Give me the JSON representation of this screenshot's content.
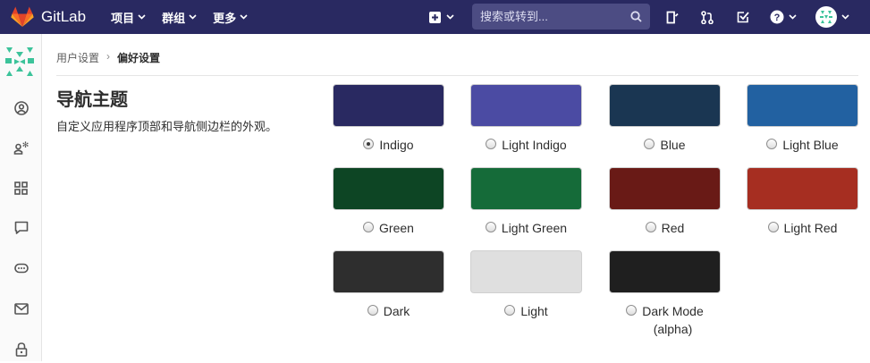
{
  "app": {
    "name": "GitLab"
  },
  "nav": {
    "menu": [
      {
        "label": "项目"
      },
      {
        "label": "群组"
      },
      {
        "label": "更多"
      }
    ],
    "search_placeholder": "搜索或转到..."
  },
  "breadcrumb": {
    "parent": "用户设置",
    "current": "偏好设置"
  },
  "section": {
    "title": "导航主题",
    "description": "自定义应用程序顶部和导航侧边栏的外观。"
  },
  "themes": [
    {
      "label": "Indigo",
      "color": "#292961",
      "selected": true
    },
    {
      "label": "Light Indigo",
      "color": "#4b4ba3",
      "selected": false
    },
    {
      "label": "Blue",
      "color": "#1a3652",
      "selected": false
    },
    {
      "label": "Light Blue",
      "color": "#2261a1",
      "selected": false
    },
    {
      "label": "Green",
      "color": "#0d4524",
      "selected": false
    },
    {
      "label": "Light Green",
      "color": "#156b39",
      "selected": false
    },
    {
      "label": "Red",
      "color": "#691a16",
      "selected": false
    },
    {
      "label": "Light Red",
      "color": "#a62e21",
      "selected": false
    },
    {
      "label": "Dark",
      "color": "#2e2e2e",
      "selected": false
    },
    {
      "label": "Light",
      "color": "#dfdfdf",
      "selected": false
    },
    {
      "label": "Dark Mode",
      "label_line2": "(alpha)",
      "color": "#1f1f1f",
      "selected": false
    }
  ],
  "colors": {
    "navbar": "#292961",
    "search_bg": "#4c4c83",
    "sidebar_bg": "#fafafa"
  },
  "icons": {
    "sidebar": [
      "avatar-identicon",
      "profile-icon",
      "account-icon",
      "applications-icon",
      "comment-icon",
      "token-icon",
      "email-icon",
      "lock-icon"
    ],
    "navbar": [
      "gitlab-logo",
      "plus-square-icon",
      "search-icon",
      "todo-doc-icon",
      "merge-request-icon",
      "issues-check-icon",
      "help-icon",
      "user-avatar"
    ]
  }
}
